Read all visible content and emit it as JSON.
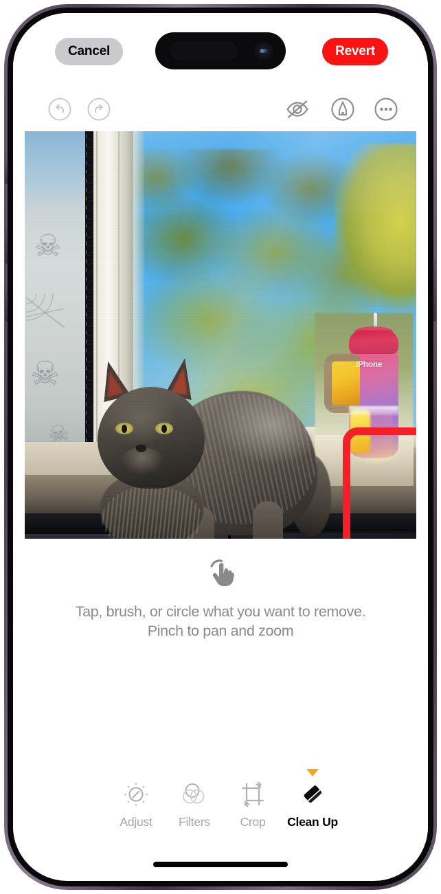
{
  "app": {
    "name": "Photos",
    "screen": "Photo Editor — Clean Up"
  },
  "top_bar": {
    "cancel_label": "Cancel",
    "revert_label": "Revert",
    "cancel_bg_color": "#c9c9ce",
    "revert_bg_color": "#fb1212"
  },
  "edit_tools": {
    "undo": "undo-icon",
    "redo": "redo-icon",
    "hide_markup": "eye-slash-icon",
    "markup": "markup-pen-icon",
    "more": "more-options-icon"
  },
  "photo": {
    "subject": "Gray fluffy cat on a dark table in front of a sunlit window",
    "highlight_box_color": "#f41f28",
    "highlighted_object": "Pink and purple insulated tumbler with handle on the windowsill",
    "tumbler_logo": "iPhone"
  },
  "instruction": {
    "line1": "Tap, brush, or circle what you want to remove.",
    "line2": "Pinch to pan and zoom",
    "icon": "tap-hand-icon"
  },
  "modes": [
    {
      "label": "Adjust",
      "icon": "adjust-icon",
      "active": false
    },
    {
      "label": "Filters",
      "icon": "filters-icon",
      "active": false
    },
    {
      "label": "Crop",
      "icon": "crop-icon",
      "active": false
    },
    {
      "label": "Clean Up",
      "icon": "eraser-icon",
      "active": true
    }
  ],
  "active_mode_indicator_color": "#f8a61a"
}
